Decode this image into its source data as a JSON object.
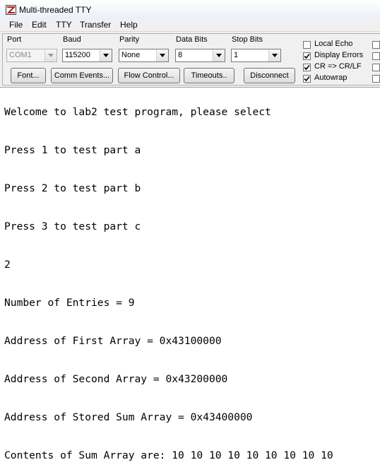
{
  "window": {
    "title": "Multi-threaded TTY"
  },
  "menu": [
    {
      "label": "File"
    },
    {
      "label": "Edit"
    },
    {
      "label": "TTY"
    },
    {
      "label": "Transfer"
    },
    {
      "label": "Help"
    }
  ],
  "settings": {
    "port": {
      "label": "Port",
      "value": "COM1"
    },
    "baud": {
      "label": "Baud",
      "value": "115200"
    },
    "parity": {
      "label": "Parity",
      "value": "None"
    },
    "data_bits": {
      "label": "Data Bits",
      "value": "8"
    },
    "stop_bits": {
      "label": "Stop Bits",
      "value": "1"
    }
  },
  "buttons": {
    "font": "Font...",
    "comm_events": "Comm Events...",
    "flow_control": "Flow Control...",
    "timeouts": "Timeouts..",
    "disconnect": "Disconnect"
  },
  "checkboxes": [
    {
      "label": "Local Echo",
      "checked": false
    },
    {
      "label": "Display Errors",
      "checked": true
    },
    {
      "label": "CR => CR/LF",
      "checked": true
    },
    {
      "label": "Autowrap",
      "checked": true
    }
  ],
  "terminal": {
    "lines": [
      "Welcome to lab2 test program, please select",
      "Press 1 to test part a",
      "Press 2 to test part b",
      "Press 3 to test part c",
      "2",
      "Number of Entries = 9",
      "Address of First Array = 0x43100000",
      "Address of Second Array = 0x43200000",
      "Address of Stored Sum Array = 0x43400000",
      "Contents of Sum Array are: 10 10 10 10 10 10 10 10 10"
    ]
  }
}
